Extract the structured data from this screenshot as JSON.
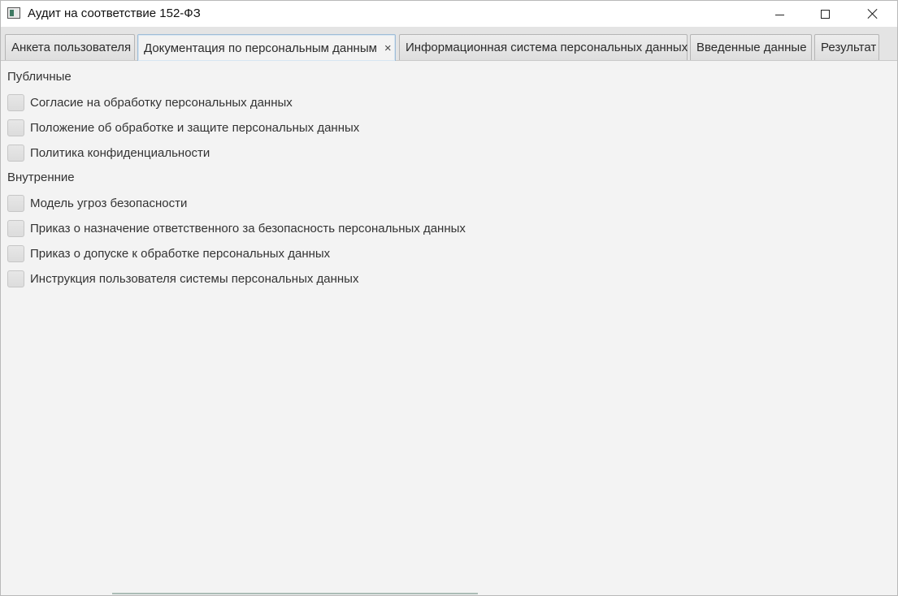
{
  "window": {
    "title": "Аудит на соответствие 152-ФЗ"
  },
  "tabs": [
    {
      "label": "Анкета пользователя",
      "active": false
    },
    {
      "label": "Документация по персональным данным",
      "active": true,
      "close_glyph": "×"
    },
    {
      "label": "Информационная система персональных данных",
      "active": false
    },
    {
      "label": "Введенные данные",
      "active": false
    },
    {
      "label": "Результат",
      "active": false
    }
  ],
  "sections": {
    "public": {
      "label": "Публичные",
      "items": [
        {
          "label": "Согласие на обработку персональных данных",
          "checked": false
        },
        {
          "label": "Положение об обработке и защите персональных данных",
          "checked": false
        },
        {
          "label": "Политика конфиденциальности",
          "checked": false
        }
      ]
    },
    "internal": {
      "label": "Внутренние",
      "items": [
        {
          "label": "Модель угроз безопасности",
          "checked": false
        },
        {
          "label": "Приказ о назначение ответственного за безопасность персональных данных",
          "checked": false
        },
        {
          "label": "Приказ о допуске к обработке персональных данных",
          "checked": false
        },
        {
          "label": "Инструкция пользователя системы персональных данных",
          "checked": false
        }
      ]
    }
  },
  "icons": {
    "app": "app-icon",
    "minimize": "minimize-icon",
    "maximize": "maximize-icon",
    "close": "close-icon"
  }
}
